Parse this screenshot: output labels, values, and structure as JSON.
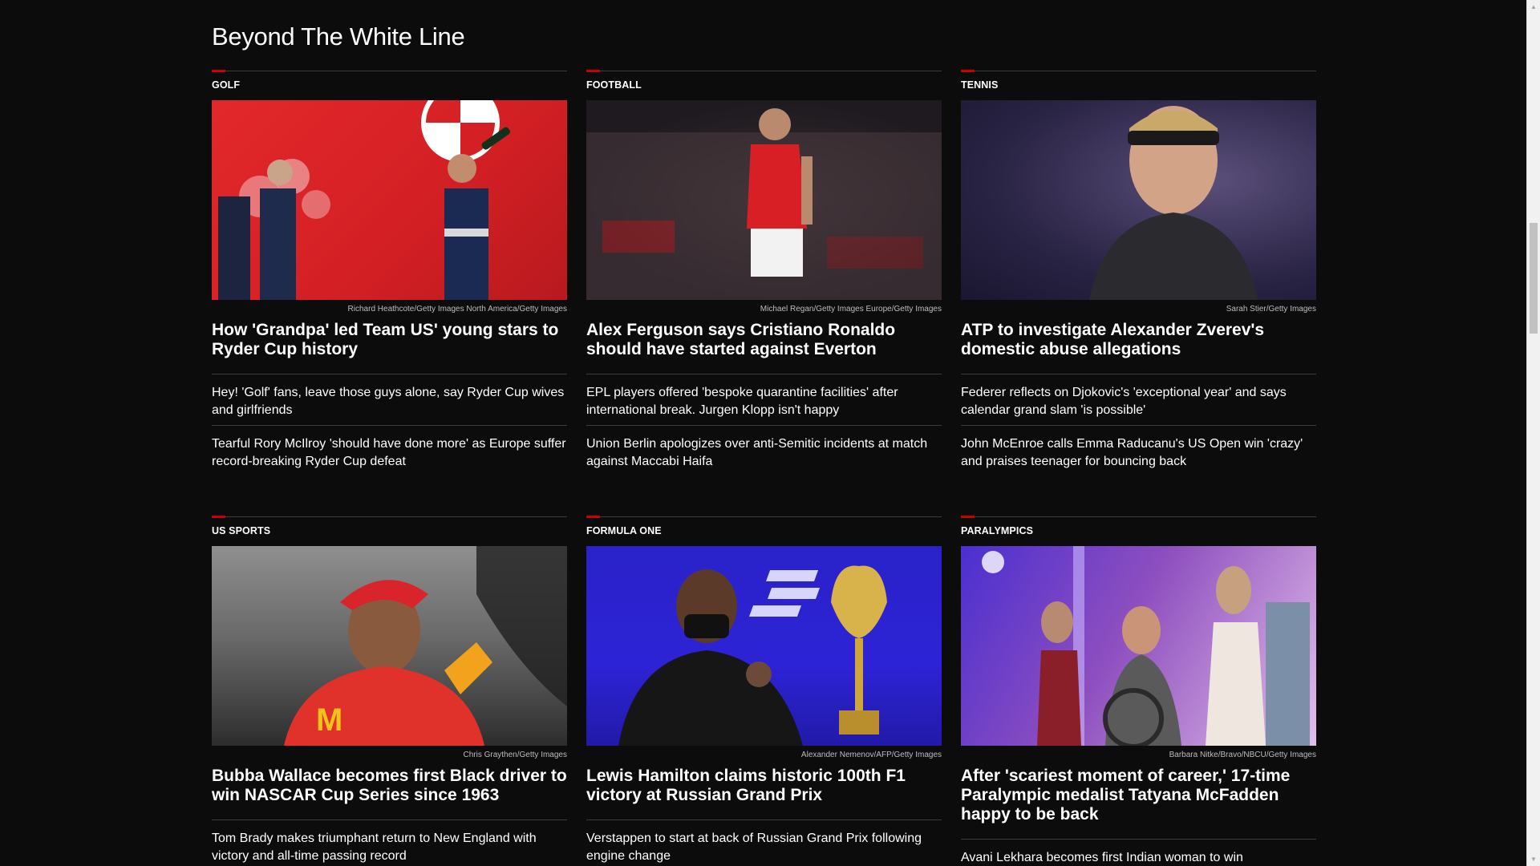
{
  "section": {
    "title": "Beyond The White Line"
  },
  "cards": [
    {
      "category": "GOLF",
      "credit": "Richard Heathcote/Getty Images North America/Getty Images",
      "headline": "How 'Grandpa' led Team US' young stars to Ryder Cup history",
      "stories": [
        "Hey! 'Golf' fans, leave those guys alone, say Ryder Cup wives and girlfriends",
        "Tearful Rory McIlroy 'should have done more' as Europe suffer record-breaking Ryder Cup defeat"
      ]
    },
    {
      "category": "FOOTBALL",
      "credit": "Michael Regan/Getty Images Europe/Getty Images",
      "headline": "Alex Ferguson says Cristiano Ronaldo should have started against Everton",
      "stories": [
        "EPL players offered 'bespoke quarantine facilities' after international break. Jurgen Klopp isn't happy",
        "Union Berlin apologizes over anti-Semitic incidents at match against Maccabi Haifa"
      ]
    },
    {
      "category": "TENNIS",
      "credit": "Sarah Stier/Getty Images",
      "headline": "ATP to investigate Alexander Zverev's domestic abuse allegations",
      "stories": [
        "Federer reflects on Djokovic's 'exceptional year' and says calendar grand slam 'is possible'",
        "John McEnroe calls Emma Raducanu's US Open win 'crazy' and praises teenager for bouncing back"
      ]
    },
    {
      "category": "US SPORTS",
      "credit": "Chris Graythen/Getty Images",
      "headline": "Bubba Wallace becomes first Black driver to win NASCAR Cup Series since 1963",
      "stories": [
        "Tom Brady makes triumphant return to New England with victory and all-time passing record"
      ]
    },
    {
      "category": "FORMULA ONE",
      "credit": "Alexander Nemenov/AFP/Getty Images",
      "headline": "Lewis Hamilton claims historic 100th F1 victory at Russian Grand Prix",
      "stories": [
        "Verstappen to start at back of Russian Grand Prix following engine change"
      ]
    },
    {
      "category": "PARALYMPICS",
      "credit": "Barbara Nitke/Bravo/NBCU/Getty Images",
      "headline": "After 'scariest moment of career,' 17-time Paralympic medalist Tatyana McFadden happy to be back",
      "stories": [
        "Avani Lekhara becomes first Indian woman to win"
      ]
    }
  ],
  "colors": {
    "accent": "#cc0000",
    "background": "#0c0c0c",
    "divider": "#3c3c3c"
  }
}
